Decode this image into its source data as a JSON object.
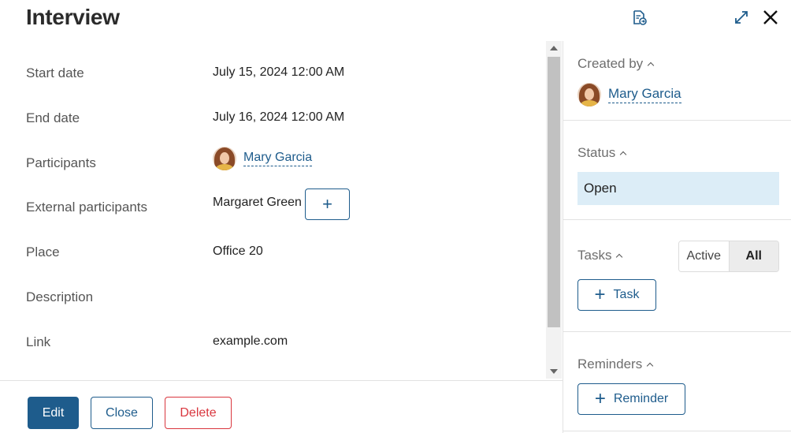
{
  "header": {
    "title": "Interview",
    "doc_icon": "document-export-icon",
    "expand_icon": "expand-icon",
    "close_icon": "close-icon"
  },
  "fields": {
    "start_date": {
      "label": "Start date",
      "value": "July 15, 2024 12:00 AM"
    },
    "end_date": {
      "label": "End date",
      "value": "July 16, 2024 12:00 AM"
    },
    "participants": {
      "label": "Participants",
      "value": "Mary Garcia"
    },
    "external_participants": {
      "label": "External participants",
      "value": "Margaret Green",
      "add": "+"
    },
    "place": {
      "label": "Place",
      "value": "Office 20"
    },
    "description": {
      "label": "Description",
      "value": ""
    },
    "link": {
      "label": "Link",
      "value": "example.com"
    }
  },
  "footer": {
    "edit": "Edit",
    "close": "Close",
    "delete": "Delete"
  },
  "sidebar": {
    "created_by": {
      "title": "Created by",
      "user": "Mary Garcia"
    },
    "status": {
      "title": "Status",
      "value": "Open"
    },
    "tasks": {
      "title": "Tasks",
      "filter_active": "Active",
      "filter_all": "All",
      "add": "Task"
    },
    "reminders": {
      "title": "Reminders",
      "add": "Reminder"
    }
  },
  "colors": {
    "accent": "#1e5c8c",
    "danger": "#d9363e",
    "status_bg": "#dcedf7"
  }
}
